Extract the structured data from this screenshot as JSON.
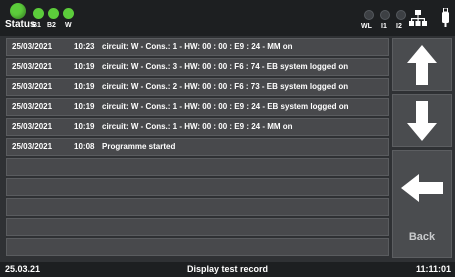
{
  "status_bar": {
    "status_label": "Status",
    "status_led_color": "#5ccc3b",
    "b_leds": [
      {
        "label": "B1",
        "color": "#5ccc3b"
      },
      {
        "label": "B2",
        "color": "#5ccc3b"
      },
      {
        "label": "W",
        "color": "#5ccc3b"
      }
    ],
    "right_leds": [
      {
        "label": "WL"
      },
      {
        "label": "I1"
      },
      {
        "label": "I2"
      }
    ],
    "network_icon": "network-icon",
    "usb_icon": "usb-icon"
  },
  "log": {
    "entries": [
      {
        "date": "25/03/2021",
        "time": "10:23",
        "text": "circuit:  W - Cons.:  1 - HW: 00 : 00 : E9 : 24 - MM on"
      },
      {
        "date": "25/03/2021",
        "time": "10:19",
        "text": "circuit:  W - Cons.:  3 - HW: 00 : 00 : F6 : 74 - EB system logged on"
      },
      {
        "date": "25/03/2021",
        "time": "10:19",
        "text": "circuit:  W - Cons.:  2 - HW: 00 : 00 : F6 : 73 - EB system logged on"
      },
      {
        "date": "25/03/2021",
        "time": "10:19",
        "text": "circuit:  W - Cons.:  1 - HW: 00 : 00 : E9 : 24 - EB system logged on"
      },
      {
        "date": "25/03/2021",
        "time": "10:19",
        "text": "circuit:  W - Cons.:  1 - HW: 00 : 00 : E9 : 24 - MM on"
      },
      {
        "date": "25/03/2021",
        "time": "10:08",
        "text": "Programme started"
      },
      {
        "date": "",
        "time": "",
        "text": ""
      },
      {
        "date": "",
        "time": "",
        "text": ""
      },
      {
        "date": "",
        "time": "",
        "text": ""
      },
      {
        "date": "",
        "time": "",
        "text": ""
      },
      {
        "date": "",
        "time": "",
        "text": ""
      }
    ]
  },
  "nav": {
    "up_icon": "arrow-up-icon",
    "down_icon": "arrow-down-icon",
    "back_icon": "arrow-left-icon",
    "back_label": "Back"
  },
  "bottom_bar": {
    "date": "25.03.21",
    "title": "Display  test record",
    "clock": "11:11:01"
  }
}
